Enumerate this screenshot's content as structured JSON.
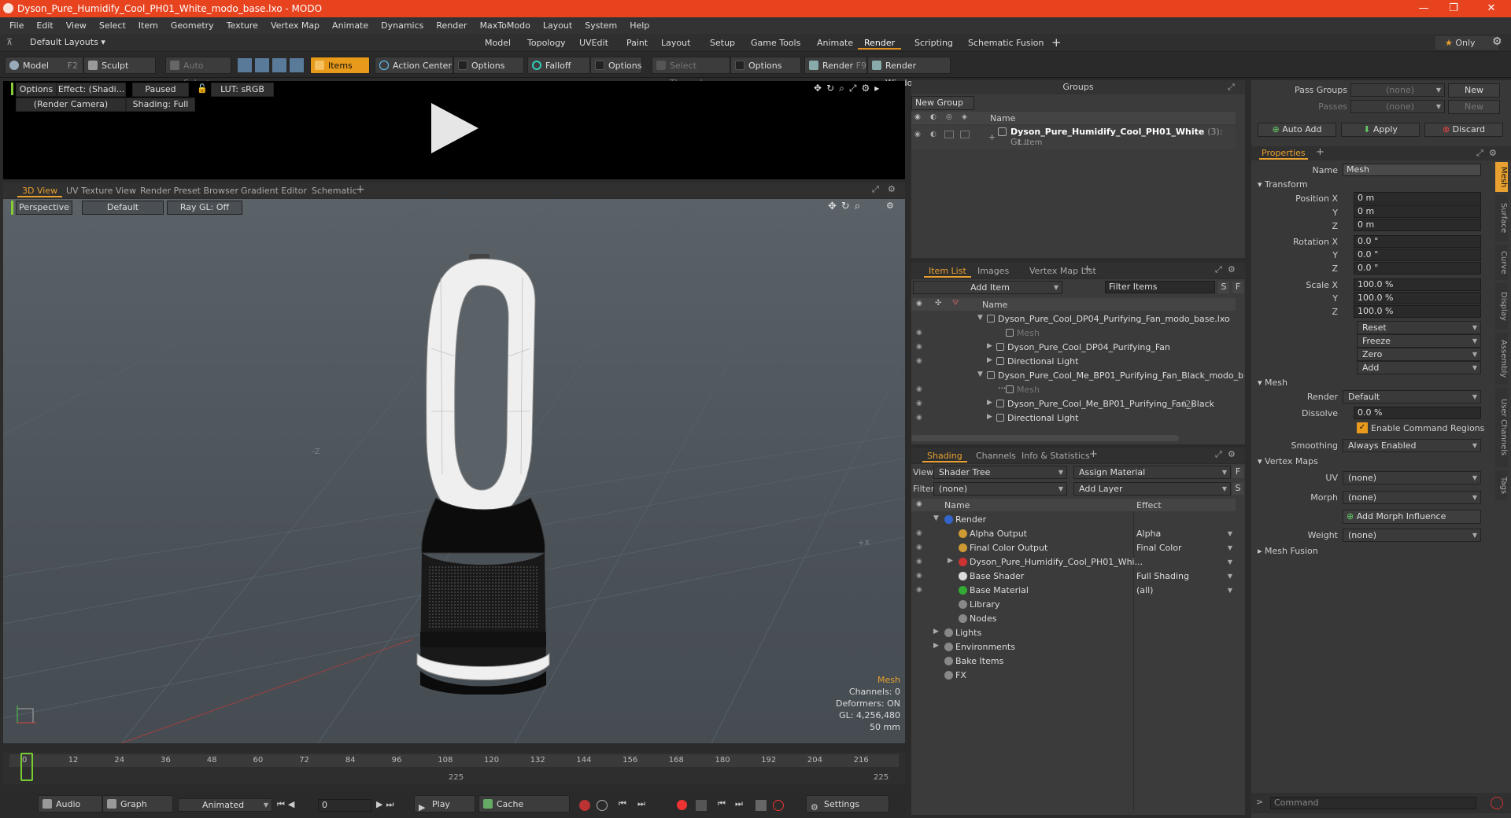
{
  "window": {
    "title": "Dyson_Pure_Humidify_Cool_PH01_White_modo_base.lxo - MODO"
  },
  "menu": [
    "File",
    "Edit",
    "View",
    "Select",
    "Item",
    "Geometry",
    "Texture",
    "Vertex Map",
    "Animate",
    "Dynamics",
    "Render",
    "MaxToModo",
    "Layout",
    "System",
    "Help"
  ],
  "layout": {
    "preset": "Default Layouts",
    "tabs": [
      "Model",
      "Topology",
      "UVEdit",
      "Paint",
      "Layout",
      "Setup",
      "Game Tools",
      "Animate",
      "Render",
      "Scripting",
      "Schematic Fusion"
    ],
    "active": "Render",
    "only": "Only"
  },
  "toolbar": {
    "model": "Model",
    "model_key": "F2",
    "sculpt": "Sculpt",
    "auto_select": "Auto Select",
    "items": "Items",
    "action_center": "Action Center",
    "options1": "Options",
    "falloff": "Falloff",
    "options2": "Options",
    "select_through": "Select Through",
    "options3": "Options",
    "render": "Render",
    "render_key": "F9",
    "render_window": "Render Window"
  },
  "render_view": {
    "options": "Options",
    "effect": "Effect: (Shadi...",
    "paused": "Paused",
    "lut": "LUT: sRGB",
    "camera": "(Render Camera)",
    "shading": "Shading: Full"
  },
  "viewport": {
    "tabs": [
      "3D View",
      "UV Texture View",
      "Render Preset Browser",
      "Gradient Editor",
      "Schematic"
    ],
    "perspective": "Perspective",
    "default": "Default",
    "raygl": "Ray GL: Off",
    "axis_z": "-Z",
    "axis_x": "+X",
    "info": {
      "mesh": "Mesh",
      "channels": "Channels: 0",
      "deformers": "Deformers: ON",
      "gl": "GL: 4,256,480",
      "focal": "50 mm"
    }
  },
  "timeline": {
    "ticks": [
      "0",
      "12",
      "24",
      "36",
      "48",
      "60",
      "72",
      "84",
      "96",
      "108",
      "120",
      "132",
      "144",
      "156",
      "168",
      "180",
      "192",
      "204",
      "216"
    ],
    "mid": "225",
    "end": "225"
  },
  "bottombar": {
    "audio": "Audio",
    "graph_editor": "Graph Editor",
    "animated": "Animated",
    "frame": "0",
    "play": "Play",
    "cache": "Cache Deformers",
    "settings": "Settings"
  },
  "groups": {
    "title": "Groups",
    "new_group": "New Group",
    "col_name": "Name",
    "item_name": "Dyson_Pure_Humidify_Cool_PH01_White",
    "item_count": "(3)",
    "item_suffix": ": Gr...",
    "item_sub": "1 Item"
  },
  "itemlist": {
    "tabs": [
      "Item List",
      "Images",
      "Vertex Map List"
    ],
    "add_item": "Add Item",
    "filter": "Filter Items",
    "col_name": "Name",
    "rows": [
      {
        "label": "Dyson_Pure_Cool_DP04_Purifying_Fan_modo_base.lxo",
        "indent": 0,
        "dim": false
      },
      {
        "label": "Mesh",
        "indent": 2,
        "dim": true
      },
      {
        "label": "Dyson_Pure_Cool_DP04_Purifying_Fan",
        "indent": 1,
        "dim": false
      },
      {
        "label": "Directional Light",
        "indent": 1,
        "dim": false
      },
      {
        "label": "Dyson_Pure_Cool_Me_BP01_Purifying_Fan_Black_modo_b ...",
        "indent": 0,
        "dim": false
      },
      {
        "label": "Mesh",
        "indent": 2,
        "dim": true
      },
      {
        "label": "Dyson_Pure_Cool_Me_BP01_Purifying_Fan_Black",
        "indent": 1,
        "dim": false,
        "count": "(2)"
      },
      {
        "label": "Directional Light",
        "indent": 1,
        "dim": false
      }
    ]
  },
  "shading": {
    "tabs": [
      "Shading",
      "Channels",
      "Info & Statistics"
    ],
    "view_label": "View",
    "view": "Shader Tree",
    "assign": "Assign Material",
    "filter_label": "Filter",
    "filter": "(none)",
    "add_layer": "Add Layer",
    "col_name": "Name",
    "col_effect": "Effect",
    "rows": [
      {
        "name": "Render",
        "effect": "",
        "indent": 0
      },
      {
        "name": "Alpha Output",
        "effect": "Alpha",
        "indent": 1
      },
      {
        "name": "Final Color Output",
        "effect": "Final Color",
        "indent": 1
      },
      {
        "name": "Dyson_Pure_Humidify_Cool_PH01_Whi...",
        "effect": "",
        "indent": 1
      },
      {
        "name": "Base Shader",
        "effect": "Full Shading",
        "indent": 1
      },
      {
        "name": "Base Material",
        "effect": "(all)",
        "indent": 1
      },
      {
        "name": "Library",
        "effect": "",
        "indent": 1
      },
      {
        "name": "Nodes",
        "effect": "",
        "indent": 1
      },
      {
        "name": "Lights",
        "effect": "",
        "indent": 0
      },
      {
        "name": "Environments",
        "effect": "",
        "indent": 0
      },
      {
        "name": "Bake Items",
        "effect": "",
        "indent": 0
      },
      {
        "name": "FX",
        "effect": "",
        "indent": 0
      }
    ]
  },
  "props": {
    "pass_groups": "Pass Groups",
    "pass_groups_val": "(none)",
    "passes": "Passes",
    "passes_val": "(none)",
    "new": "New",
    "auto_add": "Auto Add",
    "apply": "Apply",
    "discard": "Discard",
    "tab": "Properties",
    "name_label": "Name",
    "name": "Mesh",
    "transform": "Transform",
    "position": "Position X",
    "y": "Y",
    "z": "Z",
    "pos": [
      "0 m",
      "0 m",
      "0 m"
    ],
    "rotation": "Rotation X",
    "rot": [
      "0.0 °",
      "0.0 °",
      "0.0 °"
    ],
    "scale": "Scale X",
    "scl": [
      "100.0 %",
      "100.0 %",
      "100.0 %"
    ],
    "reset": "Reset",
    "freeze": "Freeze",
    "zero": "Zero",
    "add": "Add",
    "mesh": "Mesh",
    "render_label": "Render",
    "render_val": "Default",
    "dissolve_label": "Dissolve",
    "dissolve": "0.0 %",
    "enable_cmd": "Enable Command Regions",
    "smoothing_label": "Smoothing",
    "smoothing": "Always Enabled",
    "vertex_maps": "Vertex Maps",
    "uv_label": "UV",
    "uv": "(none)",
    "morph_label": "Morph",
    "morph": "(none)",
    "add_morph": "Add Morph Influence",
    "weight_label": "Weight",
    "weight": "(none)",
    "mesh_fusion": "Mesh Fusion",
    "command": "Command",
    "side_tabs": [
      "Mesh",
      "Surface",
      "Curve",
      "Display",
      "Assembly",
      "User Channels",
      "Tags"
    ]
  }
}
